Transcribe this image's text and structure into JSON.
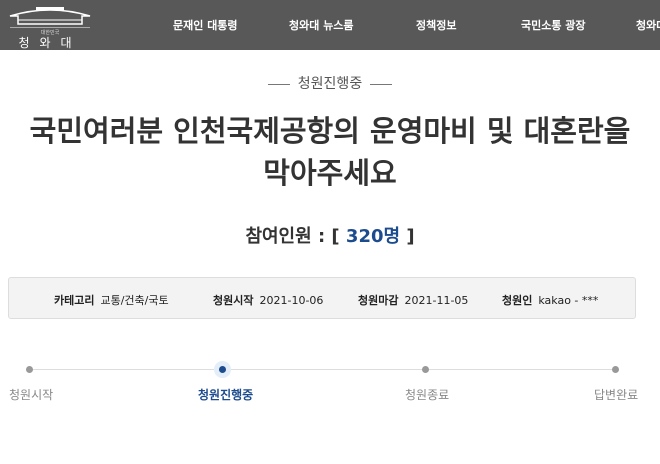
{
  "header": {
    "logo_sub": "대한민국",
    "logo_name": "청와대",
    "menu": [
      "문재인 대통령",
      "청와대 뉴스룸",
      "정책정보",
      "국민소통 광장",
      "청와대"
    ]
  },
  "petition": {
    "status": "청원진행중",
    "title": "국민여러분 인천국제공항의 운영마비 및 대혼란을 막아주세요",
    "count_label": "참여인원 : [",
    "count": "320명",
    "count_close": " ]"
  },
  "info": [
    {
      "label": "카테고리",
      "value": "교통/건축/국토"
    },
    {
      "label": "청원시작",
      "value": "2021-10-06"
    },
    {
      "label": "청원마감",
      "value": "2021-11-05"
    },
    {
      "label": "청원인",
      "value": "kakao - ***"
    }
  ],
  "steps": [
    "청원시작",
    "청원진행중",
    "청원종료",
    "답변완료"
  ],
  "active_step": 1
}
